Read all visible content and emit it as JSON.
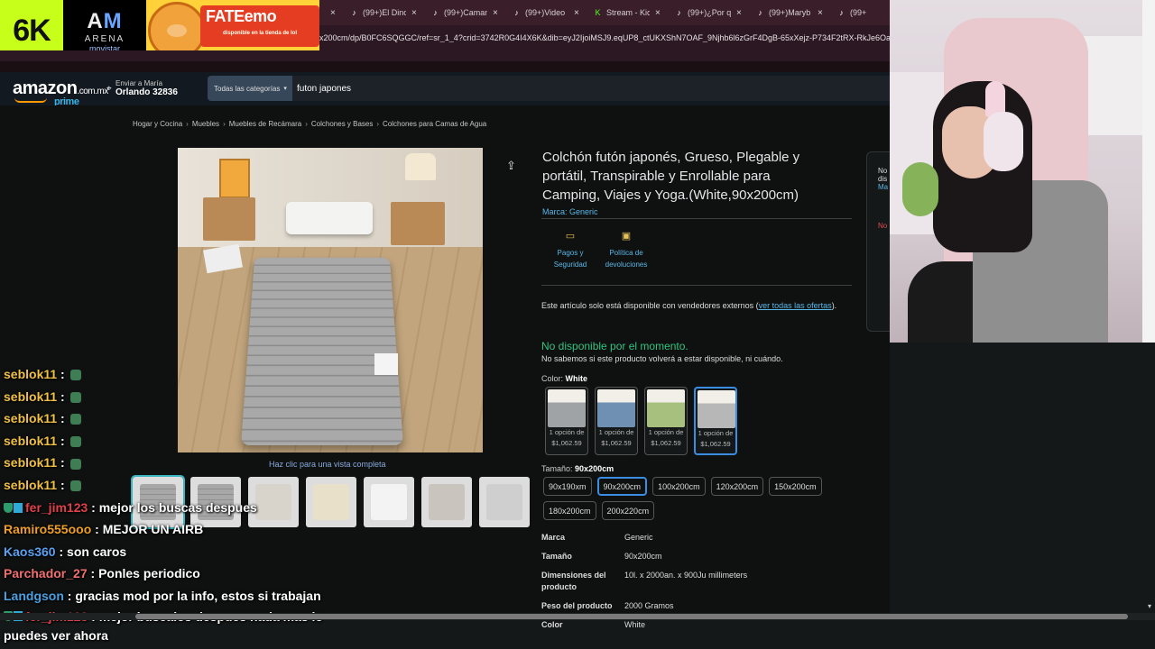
{
  "tabs": [
    {
      "label": "",
      "icon": "close-icon"
    },
    {
      "label": "(99+)El Dino",
      "icon": "tiktok-icon"
    },
    {
      "label": "(99+)Caman",
      "icon": "tiktok-icon"
    },
    {
      "label": "(99+)Video",
      "icon": "tiktok-icon"
    },
    {
      "label": "Stream - Kic",
      "icon": "kick-icon"
    },
    {
      "label": "(99+)¿Por qu",
      "icon": "tiktok-icon"
    },
    {
      "label": "(99+)Maryb",
      "icon": "tiktok-icon"
    },
    {
      "label": "(99+",
      "icon": "tiktok-icon"
    }
  ],
  "url": "x200cm/dp/B0FC6SQGGC/ref=sr_1_4?crid=3742R0G4I4X6K&dib=eyJ2IjoiMSJ9.eqUP8_ctUKXShN7OAF_9Njhb6l6zGrF4DgB-65xXejz-P734F2tRX-RkJe6Oao",
  "stream_logos": {
    "logo1": "6K",
    "logo2_line1": "ARENA",
    "logo2_line2": "movistar",
    "logo3_title": "FATEemo",
    "logo3_sub": "disponible en la tienda de lol"
  },
  "header": {
    "logo_text": "amazon",
    "logo_tld": ".com.mx",
    "logo_prime": "prime",
    "deliver_line1": "Enviar a María",
    "deliver_line2": "Orlando 32836",
    "category": "Todas las categorías",
    "search_value": "futon japones"
  },
  "breadcrumb": [
    "Hogar y Cocina",
    "Muebles",
    "Muebles de Recámara",
    "Colchones y Bases",
    "Colchones para Camas de Agua"
  ],
  "product": {
    "title": "Colchón futón japonés, Grueso, Plegable y portátil, Transpirable y Enrollable para Camping, Viajes y Yoga.(White,90x200cm)",
    "brand": "Marca: Generic",
    "zoom_hint": "Haz clic para una vista completa",
    "badges": [
      {
        "label": "Pagos y Seguridad",
        "icon": "card-icon"
      },
      {
        "label": "Política de devoluciones",
        "icon": "box-icon"
      }
    ],
    "notice_text": "Este artículo solo está disponible con vendedores externos (",
    "notice_link": "ver todas las ofertas",
    "notice_end": ").",
    "unavailable": "No disponible por el momento.",
    "unavailable_sub": "No sabemos si este producto volverá a estar disponible, ni cuándo.",
    "color_label": "Color:",
    "color_value": "White",
    "colors": [
      {
        "line1": "1 opción de",
        "line2": "$1,062.59",
        "color": "#9fa3a6"
      },
      {
        "line1": "1 opción de",
        "line2": "$1,062.59",
        "color": "#6f8fb3"
      },
      {
        "line1": "1 opción de",
        "line2": "$1,062.59",
        "color": "#a7c07d"
      },
      {
        "line1": "1 opción de",
        "line2": "$1,062.59",
        "color": "#b7b7b7"
      }
    ],
    "size_label": "Tamaño:",
    "size_value": "90x200cm",
    "sizes": [
      "90x190xm",
      "90x200cm",
      "100x200cm",
      "120x200cm",
      "150x200cm",
      "180x200cm",
      "200x220cm"
    ],
    "specs": [
      {
        "k": "Marca",
        "v": "Generic"
      },
      {
        "k": "Tamaño",
        "v": "90x200cm"
      },
      {
        "k": "Dimensiones del producto",
        "v": "10l. x 2000an. x 900Ju millimeters"
      },
      {
        "k": "Peso del producto",
        "v": "2000 Gramos"
      },
      {
        "k": "Color",
        "v": "White"
      }
    ]
  },
  "buybox": {
    "line1": "No",
    "line2": "dis",
    "line3": "Ma",
    "line4": "No"
  },
  "chat": [
    {
      "user": "seblok11",
      "color": "#f0c043",
      "msg": ""
    },
    {
      "user": "seblok11",
      "color": "#f0c043",
      "msg": ""
    },
    {
      "user": "seblok11",
      "color": "#f0c043",
      "msg": ""
    },
    {
      "user": "seblok11",
      "color": "#f0c043",
      "msg": ""
    },
    {
      "user": "seblok11",
      "color": "#f0c043",
      "msg": ""
    },
    {
      "user": "seblok11",
      "color": "#f0c043",
      "msg": ""
    },
    {
      "user": "fer_jim123",
      "color": "#e0404a",
      "msg": "mejor los buscas despues"
    },
    {
      "user": "Ramiro555ooo",
      "color": "#f0a020",
      "msg": "MEJOR UN AIRB"
    },
    {
      "user": "Kaos360",
      "color": "#5aa0f0",
      "msg": "son caros"
    },
    {
      "user": "Parchador_27",
      "color": "#f07070",
      "msg": "Ponles periodico"
    },
    {
      "user": "Landgson",
      "color": "#4aa0e0",
      "msg": "gracias mod por la info, estos si trabajan"
    },
    {
      "user": "fer_jim123",
      "color": "#e0404a",
      "msg": "mejor buscalos despues nada mas lo puedes ver ahora"
    }
  ]
}
